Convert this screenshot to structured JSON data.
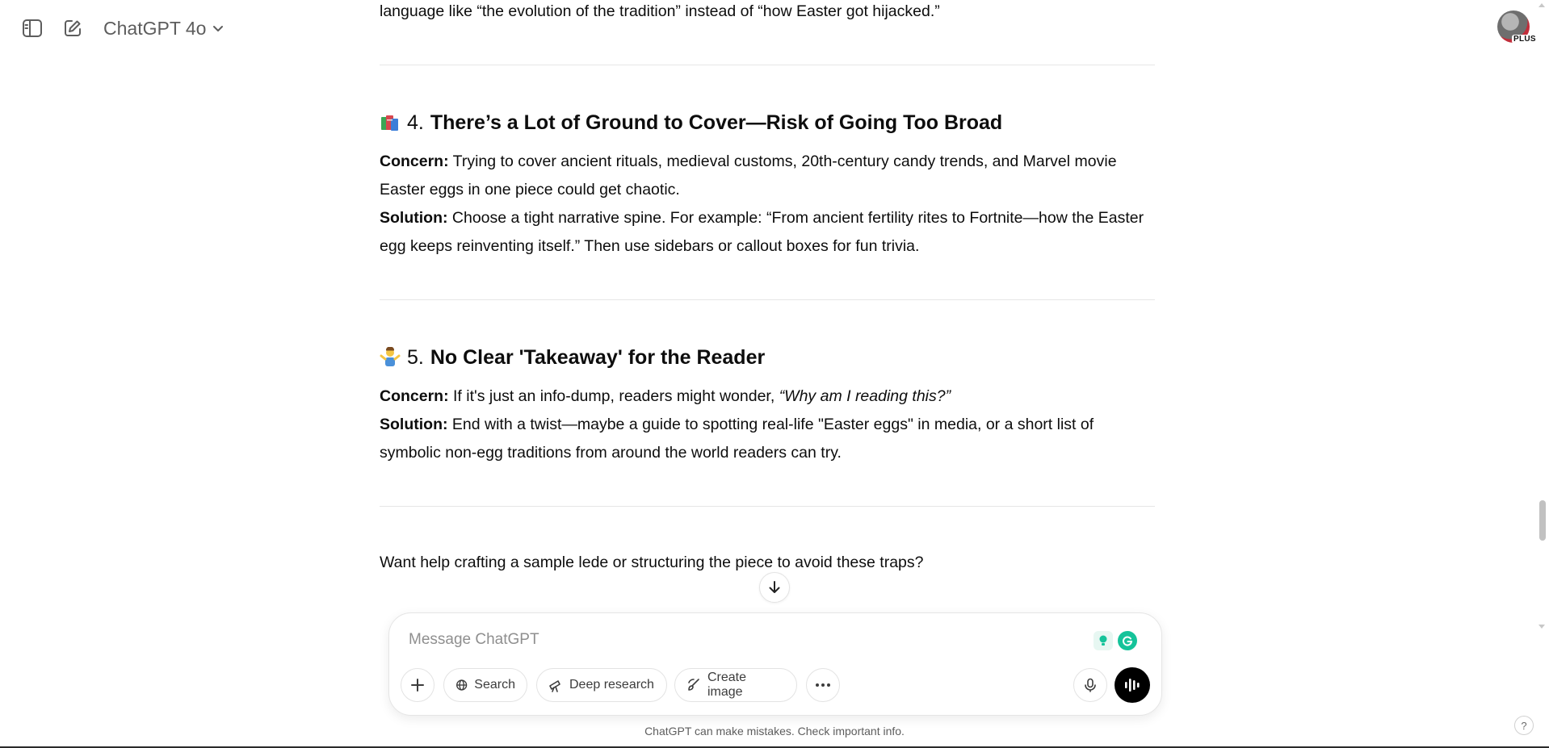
{
  "header": {
    "model_name": "ChatGPT 4o",
    "avatar_badge": "PLUS"
  },
  "icons": {
    "sidebar_toggle": "sidebar-toggle-icon",
    "new_chat": "edit-icon",
    "model_dropdown": "chevron-down-icon",
    "section4_emoji": "books-icon",
    "section5_emoji": "person-shrugging-icon",
    "scroll_down": "arrow-down-icon",
    "attach": "plus-icon",
    "search": "globe-icon",
    "deep_research": "telescope-icon",
    "create_image": "brush-icon",
    "more": "ellipsis-icon",
    "mic": "mic-icon",
    "voice": "voice-waveform-icon"
  },
  "message": {
    "prev_tail": "language like “the evolution of the tradition” instead of “how Easter got hijacked.”",
    "section4": {
      "num": "4.",
      "title": "There’s a Lot of Ground to Cover—Risk of Going Too Broad",
      "concern_label": "Concern:",
      "concern_line1": " Trying to cover ancient rituals, medieval customs, 20th-century candy trends, and Marvel movie",
      "concern_line2": "Easter eggs in one piece could get chaotic.",
      "solution_label": "Solution:",
      "solution_line1": " Choose a tight narrative spine. For example: “From ancient fertility rites to Fortnite—how the Easter",
      "solution_line2": "egg keeps reinventing itself.” Then use sidebars or callout boxes for fun trivia."
    },
    "section5": {
      "num": "5.",
      "title": "No Clear 'Takeaway' for the Reader",
      "concern_label": "Concern:",
      "concern_text": " If it's just an info-dump, readers might wonder, ",
      "concern_quote": "“Why am I reading this?”",
      "solution_label": "Solution:",
      "solution_line1": " End with a twist—maybe a guide to spotting real-life \"Easter eggs\" in media, or a short list of",
      "solution_line2": "symbolic non-egg traditions from around the world readers can try."
    },
    "closing": "Want help crafting a sample lede or structuring the piece to avoid these traps?"
  },
  "composer": {
    "placeholder": "Message ChatGPT",
    "buttons": {
      "search": "Search",
      "deep_research": "Deep research",
      "create_image": "Create image"
    }
  },
  "footer": {
    "disclaimer": "ChatGPT can make mistakes. Check important info.",
    "help": "?"
  },
  "colors": {
    "grammarly": "#15c39a",
    "accent_black": "#000000"
  }
}
